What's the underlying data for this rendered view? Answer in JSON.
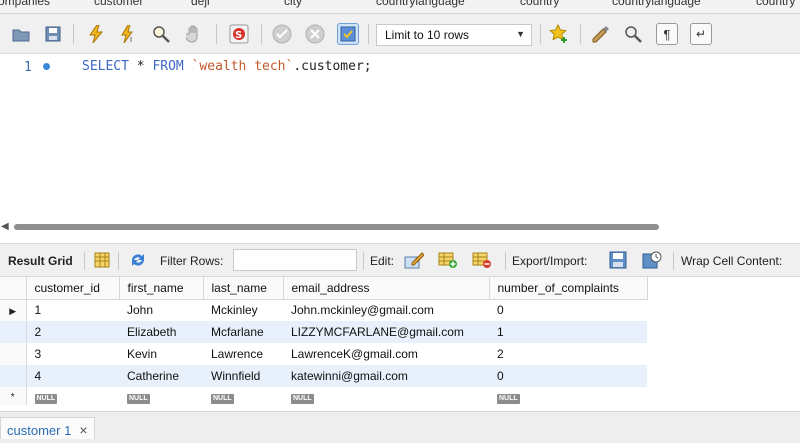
{
  "top_tabs": [
    "ompanies",
    "customer",
    "deji",
    "city",
    "countrylanguage",
    "country",
    "countrylanguage",
    "country"
  ],
  "toolbar": {
    "limit_value": "Limit to 10 rows"
  },
  "editor": {
    "line_number": "1",
    "code": {
      "kw_select": "SELECT",
      "star": " * ",
      "kw_from": "FROM",
      "space": " ",
      "schema": "`wealth tech`",
      "rest": ".customer;"
    }
  },
  "result_toolbar": {
    "result_grid": "Result Grid",
    "filter_rows": "Filter Rows:",
    "edit": "Edit:",
    "export_import": "Export/Import:",
    "wrap_cell": "Wrap Cell Content:"
  },
  "grid": {
    "columns": [
      "customer_id",
      "first_name",
      "last_name",
      "email_address",
      "number_of_complaints"
    ],
    "rows": [
      [
        "1",
        "John",
        "Mckinley",
        "John.mckinley@gmail.com",
        "0"
      ],
      [
        "2",
        "Elizabeth",
        "Mcfarlane",
        "LIZZYMCFARLANE@gmail.com",
        "1"
      ],
      [
        "3",
        "Kevin",
        "Lawrence",
        "LawrenceK@gmail.com",
        "2"
      ],
      [
        "4",
        "Catherine",
        "Winnfield",
        "katewinni@gmail.com",
        "0"
      ]
    ],
    "null_label": "NULL"
  },
  "bottom_tab": {
    "label": "customer 1",
    "close": "×"
  },
  "colors": {
    "keyword": "#3c68c7",
    "string": "#c25a2a",
    "alt_row": "#e8f0fb",
    "tab_text": "#2a6db5"
  }
}
